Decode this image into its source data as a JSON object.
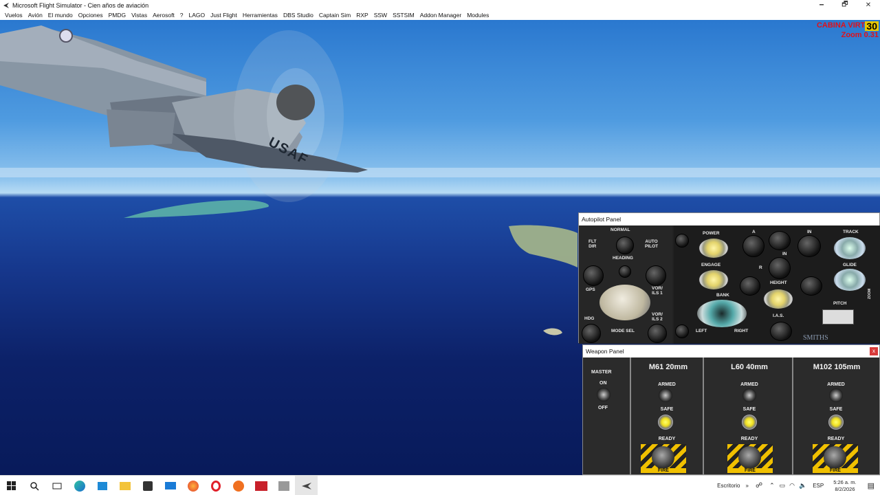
{
  "window": {
    "title": "Microsoft Flight Simulator - Cien años de aviación",
    "minimize": "🗕",
    "maximize": "🗗",
    "close": "✕"
  },
  "menu": [
    "Vuelos",
    "Avión",
    "El mundo",
    "Opciones",
    "PMDG",
    "Vistas",
    "Aerosoft",
    "?",
    "LAGO",
    "Just Flight",
    "Herramientas",
    "DBS Studio",
    "Captain Sim",
    "RXP",
    "SSW",
    "SSTSIM",
    "Addon Manager",
    "Modules"
  ],
  "hud": {
    "line1": "CABINA VIRT",
    "fps": "30",
    "line2": "Zoom 0.31"
  },
  "aircraft": {
    "marking": "USAF"
  },
  "autopilot": {
    "title": "Autopilot Panel",
    "left": {
      "normal": "NORMAL",
      "flt_dir": "FLT\nDIR",
      "auto_pilot": "AUTO\nPILOT",
      "heading": "HEADING",
      "gps": "GPS",
      "vor_ils_1": "VOR/\nILS 1",
      "hdg": "HDG",
      "vor_ils_2": "VOR/\nILS 2",
      "mode_sel": "MODE SEL"
    },
    "right": {
      "power": "POWER",
      "a": "A",
      "in1": "IN",
      "track": "TRACK",
      "engage": "ENGAGE",
      "in2": "IN",
      "r": "R",
      "glide": "GLIDE",
      "height": "HEIGHT",
      "bank": "BANK",
      "pitch": "PITCH",
      "ias": "I.A.S.",
      "left": "LEFT",
      "right": "RIGHT",
      "brand": "SMITHS",
      "zoom": "ZOOM"
    }
  },
  "weapon": {
    "title": "Weapon Panel",
    "close": "x",
    "master": {
      "label": "MASTER",
      "on": "ON",
      "off": "OFF"
    },
    "sections": [
      {
        "name": "M61 20mm",
        "armed": "ARMED",
        "safe": "SAFE",
        "ready": "READY",
        "fire": "FIRE"
      },
      {
        "name": "L60 40mm",
        "armed": "ARMED",
        "safe": "SAFE",
        "ready": "READY",
        "fire": "FIRE"
      },
      {
        "name": "M102 105mm",
        "armed": "ARMED",
        "safe": "SAFE",
        "ready": "READY",
        "fire": "FIRE"
      }
    ]
  },
  "taskbar": {
    "tray": {
      "desktop": "Escritorio",
      "chevron": "»",
      "lang": "ESP",
      "time": "5:26 a. m.",
      "date": "8/2/2026"
    }
  }
}
